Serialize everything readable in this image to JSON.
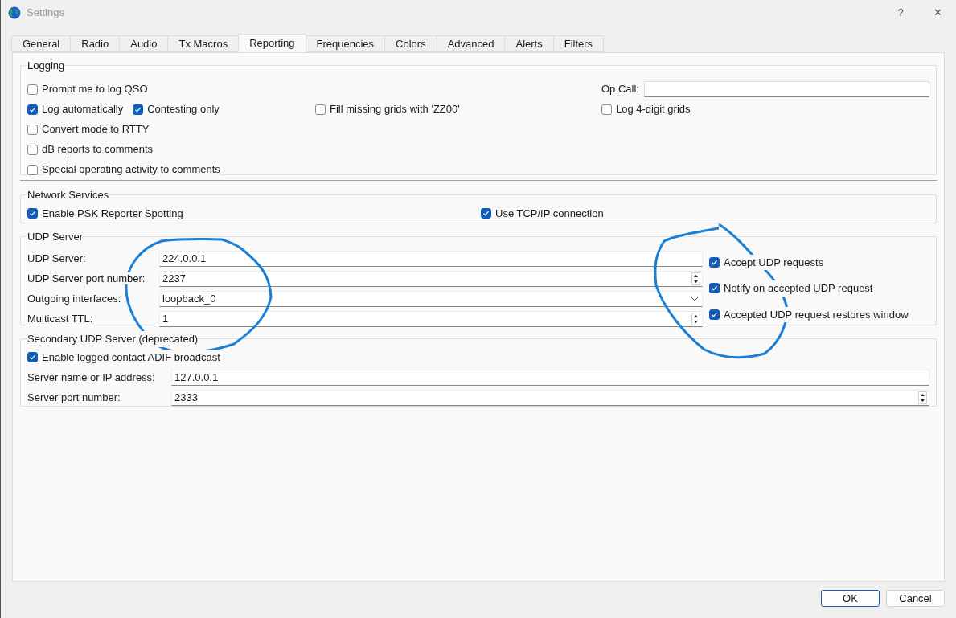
{
  "window": {
    "title": "Settings",
    "help": "?",
    "close": "✕"
  },
  "tabs": [
    {
      "label": "General",
      "selected": false
    },
    {
      "label": "Radio",
      "selected": false
    },
    {
      "label": "Audio",
      "selected": false
    },
    {
      "label": "Tx Macros",
      "selected": false
    },
    {
      "label": "Reporting",
      "selected": true
    },
    {
      "label": "Frequencies",
      "selected": false
    },
    {
      "label": "Colors",
      "selected": false
    },
    {
      "label": "Advanced",
      "selected": false
    },
    {
      "label": "Alerts",
      "selected": false
    },
    {
      "label": "Filters",
      "selected": false
    }
  ],
  "logging": {
    "title": "Logging",
    "rows": [
      {
        "left": [
          {
            "label": "Prompt me to log QSO",
            "checked": false
          }
        ],
        "right": {
          "kind": "field",
          "label": "Op Call:"
        }
      },
      {
        "left": [
          {
            "label": "Log automatically",
            "checked": true
          },
          {
            "label": "Contesting only",
            "checked": true
          }
        ],
        "middle": {
          "label": "Fill missing grids with 'ZZ00'",
          "checked": false
        },
        "right": {
          "kind": "checkbox",
          "label": "Log 4-digit grids",
          "checked": false
        }
      },
      {
        "left": [
          {
            "label": "Convert mode to RTTY",
            "checked": false
          }
        ]
      },
      {
        "left": [
          {
            "label": "dB reports to comments",
            "checked": false
          }
        ]
      },
      {
        "left": [
          {
            "label": "Special operating activity to comments",
            "checked": false
          }
        ]
      }
    ]
  },
  "network_services": {
    "title": "Network Services",
    "items": [
      {
        "label": "Enable PSK Reporter Spotting",
        "checked": true
      },
      {
        "label": "Use TCP/IP connection",
        "checked": true
      }
    ]
  },
  "udp_server": {
    "title": "UDP Server",
    "fields": [
      {
        "kind": "text",
        "label": "UDP Server:",
        "value": "224.0.0.1"
      },
      {
        "kind": "spin",
        "label": "UDP Server port number:",
        "value": "2237"
      },
      {
        "kind": "combo",
        "label": "Outgoing interfaces:",
        "value": "loopback_0"
      },
      {
        "kind": "spin",
        "label": "Multicast TTL:",
        "value": "1"
      }
    ],
    "options": [
      {
        "label": "Accept UDP requests",
        "checked": true
      },
      {
        "label": "Notify on accepted UDP request",
        "checked": true
      },
      {
        "label": "Accepted UDP request restores window",
        "checked": true
      }
    ]
  },
  "secondary_udp_server": {
    "title": "Secondary UDP Server (deprecated)",
    "broadcast": {
      "label": "Enable logged contact ADIF broadcast",
      "checked": true
    },
    "fields": [
      {
        "kind": "text",
        "label": "Server name or IP address:",
        "value": "127.0.0.1"
      },
      {
        "kind": "spin",
        "label": "Server port number:",
        "value": "2333"
      }
    ]
  },
  "buttons": [
    {
      "label": "OK",
      "default": true
    },
    {
      "label": "Cancel",
      "default": false
    }
  ]
}
